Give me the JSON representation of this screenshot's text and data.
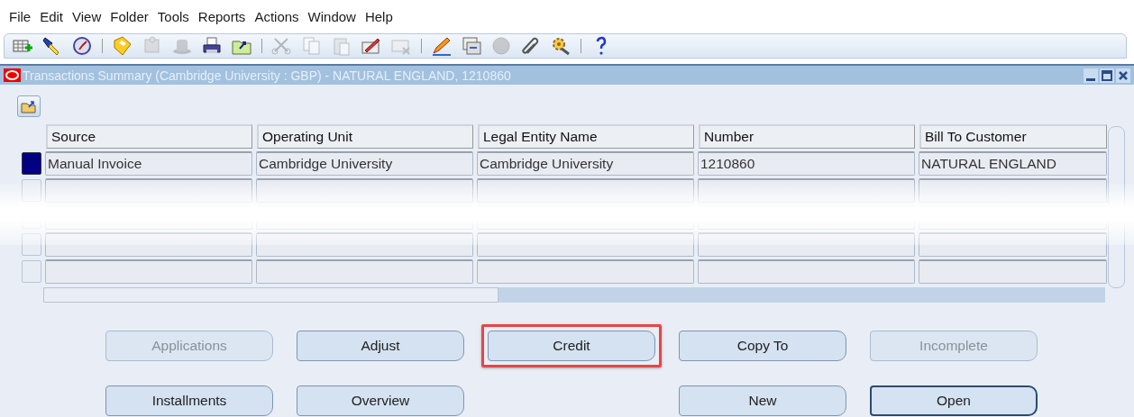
{
  "menu": [
    {
      "label": "File"
    },
    {
      "label": "Edit"
    },
    {
      "label": "View"
    },
    {
      "label": "Folder"
    },
    {
      "label": "Tools"
    },
    {
      "label": "Reports"
    },
    {
      "label": "Actions"
    },
    {
      "label": "Window"
    },
    {
      "label": "Help"
    }
  ],
  "toolbar": [
    {
      "items": [
        {
          "disabled": false
        },
        {
          "disabled": false
        },
        {
          "disabled": false
        }
      ]
    },
    {
      "items": [
        {
          "disabled": false
        },
        {
          "disabled": true
        },
        {
          "disabled": true
        },
        {
          "disabled": false
        },
        {
          "disabled": false
        }
      ]
    },
    {
      "items": [
        {
          "disabled": true
        },
        {
          "disabled": true
        },
        {
          "disabled": true
        },
        {
          "disabled": false
        },
        {
          "disabled": true
        }
      ]
    },
    {
      "items": [
        {
          "disabled": false
        },
        {
          "disabled": false
        },
        {
          "disabled": true
        },
        {
          "disabled": false
        },
        {
          "disabled": false
        }
      ]
    },
    {
      "items": [
        {
          "disabled": false
        }
      ]
    }
  ],
  "window": {
    "title": "Transactions Summary (Cambridge University : GBP) - NATURAL ENGLAND, 1210860",
    "table": {
      "columns": [
        "Source",
        "Operating Unit",
        "Legal Entity Name",
        "Number",
        "Bill To Customer"
      ],
      "rows": [
        {
          "selected": true,
          "cells": [
            "Manual Invoice",
            "Cambridge University",
            "Cambridge University",
            "1210860",
            "NATURAL ENGLAND"
          ]
        },
        {
          "selected": false,
          "cells": []
        },
        {
          "selected": false,
          "cells": []
        },
        {
          "selected": false,
          "cells": []
        },
        {
          "selected": false,
          "cells": []
        }
      ]
    },
    "button_rows": [
      {
        "left": [
          {
            "label": "Applications",
            "disabled": true,
            "highlighted": false,
            "default": false
          },
          {
            "label": "Adjust",
            "disabled": false,
            "highlighted": false,
            "default": false
          },
          {
            "label": "Credit",
            "disabled": false,
            "highlighted": true,
            "default": false
          }
        ],
        "right": [
          {
            "label": "Copy To",
            "disabled": false,
            "highlighted": false,
            "default": false
          },
          {
            "label": "Incomplete",
            "disabled": true,
            "highlighted": false,
            "default": false
          }
        ]
      },
      {
        "left": [
          {
            "label": "Installments",
            "disabled": false,
            "highlighted": false,
            "default": false
          },
          {
            "label": "Overview",
            "disabled": false,
            "highlighted": false,
            "default": false
          }
        ],
        "right": [
          {
            "label": "New",
            "disabled": false,
            "highlighted": false,
            "default": false
          },
          {
            "label": "Open",
            "disabled": false,
            "highlighted": false,
            "default": true
          }
        ]
      }
    ]
  }
}
